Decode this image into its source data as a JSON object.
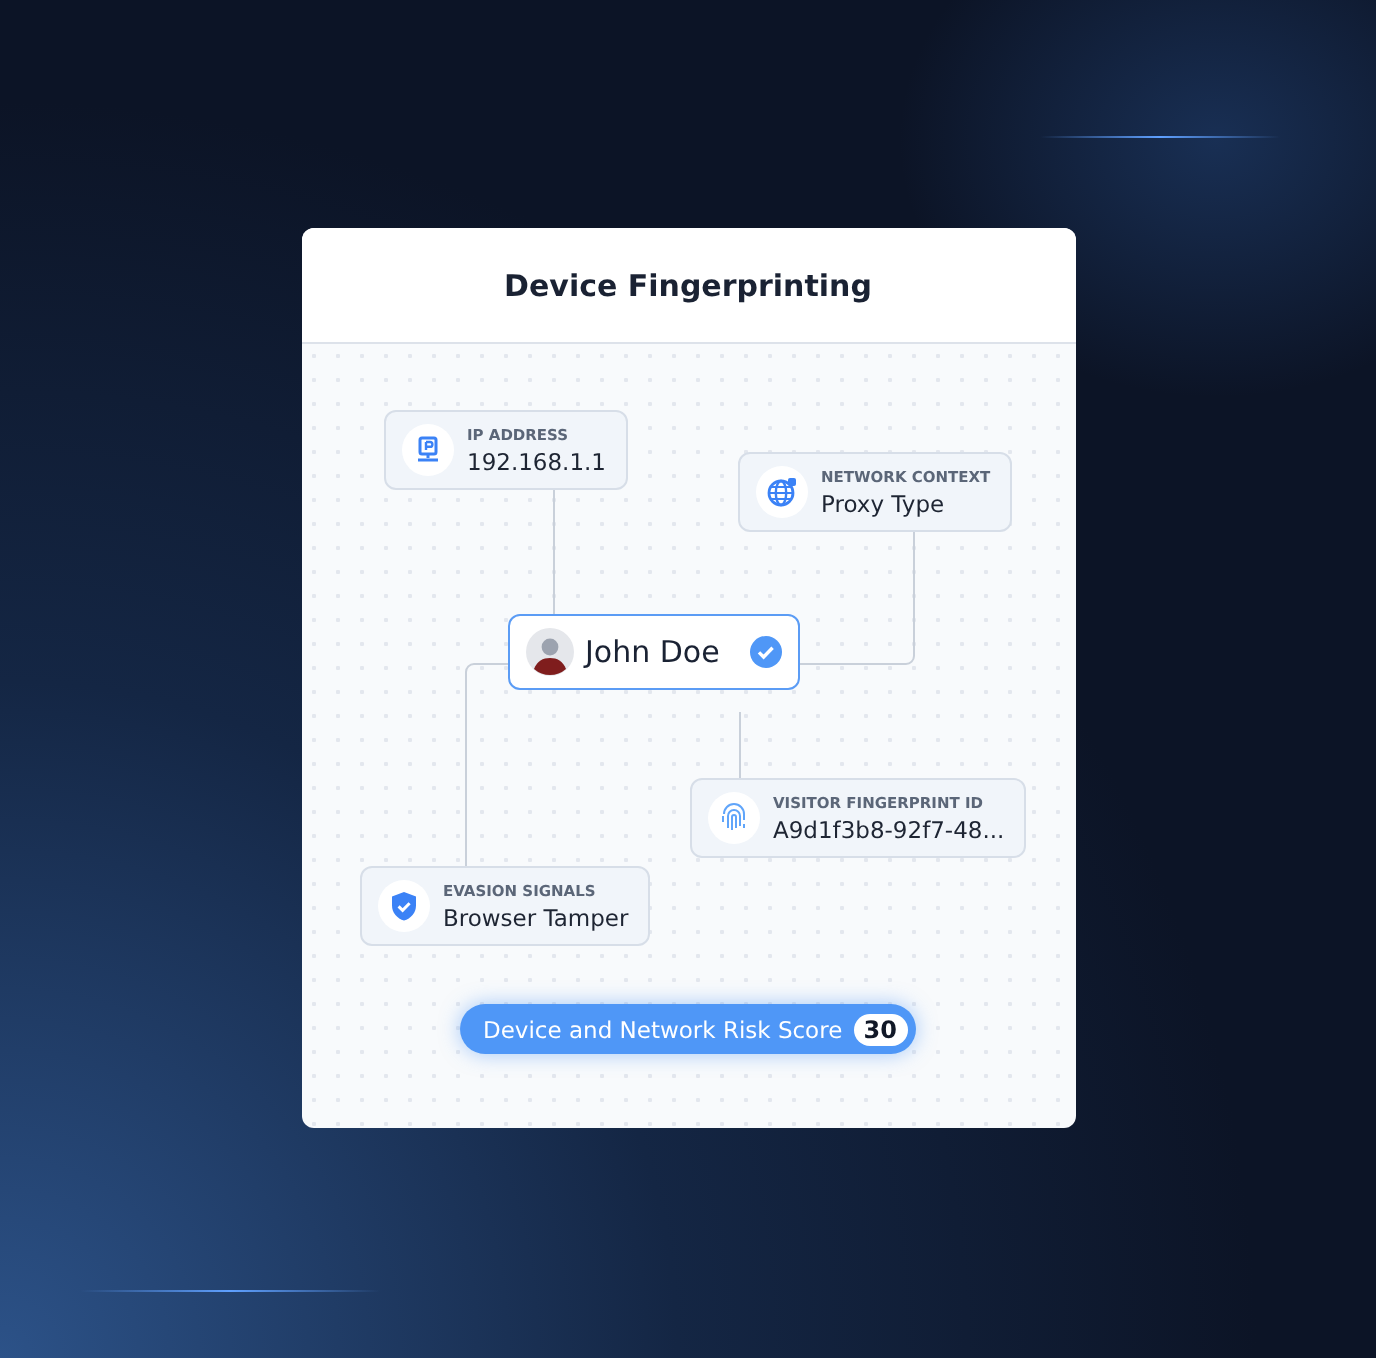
{
  "card": {
    "title": "Device Fingerprinting"
  },
  "person": {
    "name": "John Doe",
    "verified": true
  },
  "signals": [
    {
      "kind": "ip",
      "label": "IP ADDRESS",
      "value": "192.168.1.1"
    },
    {
      "kind": "globe",
      "label": "NETWORK CONTEXT",
      "value": "Proxy Type"
    },
    {
      "kind": "fingerprint",
      "label": "VISITOR FINGERPRINT ID",
      "value": "A9d1f3b8-92f7-48..."
    },
    {
      "kind": "shield",
      "label": "EVASION SIGNALS",
      "value": "Browser Tamper"
    }
  ],
  "score": {
    "label": "Device and Network Risk Score",
    "value": "30"
  }
}
